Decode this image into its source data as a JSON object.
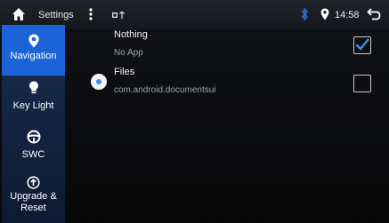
{
  "status_bar": {
    "title": "Settings",
    "time": "14:58",
    "icons": [
      "home-icon",
      "more-vert-icon",
      "notification-icons",
      "bluetooth-icon",
      "location-icon",
      "back-icon"
    ]
  },
  "sidebar": {
    "items": [
      {
        "label": "Navigation",
        "icon": "location-pin-icon",
        "active": true
      },
      {
        "label": "Key Light",
        "icon": "lightbulb-icon",
        "active": false
      },
      {
        "label": "SWC",
        "icon": "steering-wheel-icon",
        "active": false
      },
      {
        "label": "Upgrade &",
        "label2": "Reset",
        "icon": "upgrade-icon",
        "active": false
      }
    ]
  },
  "apps": [
    {
      "title": "Nothing",
      "subtitle": "No App",
      "checked": true,
      "radio": false
    },
    {
      "title": "Files",
      "subtitle": "com.android.documentsui",
      "checked": false,
      "radio": true
    }
  ],
  "colors": {
    "accent": "#1b63d6",
    "check": "#3d8fef",
    "sidebar": "#14233f"
  }
}
